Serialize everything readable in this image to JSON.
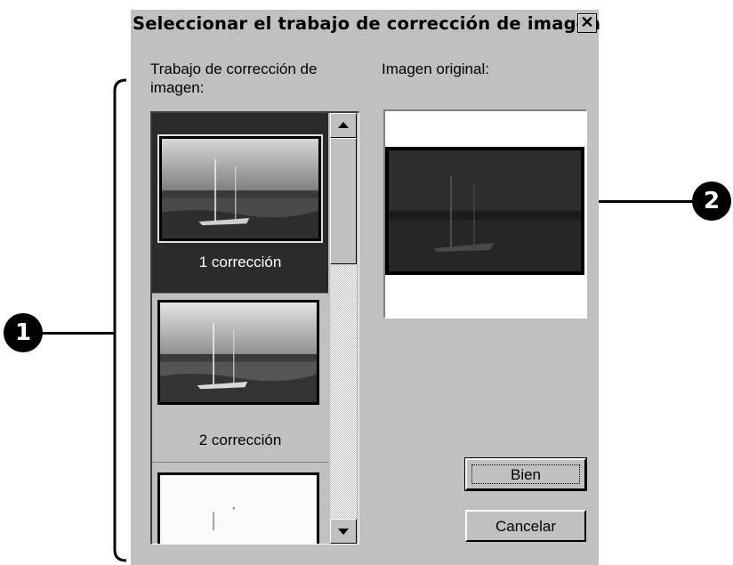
{
  "dialog": {
    "title": "Seleccionar el trabajo de corrección de imagen",
    "close_glyph": "✕"
  },
  "labels": {
    "list_label_line1": "Trabajo de corrección de",
    "list_label_line2": "imagen:",
    "original_label": "Imagen original:"
  },
  "list": {
    "items": [
      {
        "caption": "1 corrección",
        "selected": true
      },
      {
        "caption": "2 corrección",
        "selected": false
      },
      {
        "caption": "",
        "selected": false
      }
    ]
  },
  "buttons": {
    "ok": "Bien",
    "cancel": "Cancelar"
  },
  "callouts": {
    "one": "1",
    "two": "2"
  },
  "icons": {
    "scroll_up": "scroll-up-arrow-icon",
    "scroll_down": "scroll-down-arrow-icon",
    "close": "close-icon"
  },
  "colors": {
    "dialog_bg": "#c0c0c0",
    "selected_bg": "#2b2b2b"
  }
}
